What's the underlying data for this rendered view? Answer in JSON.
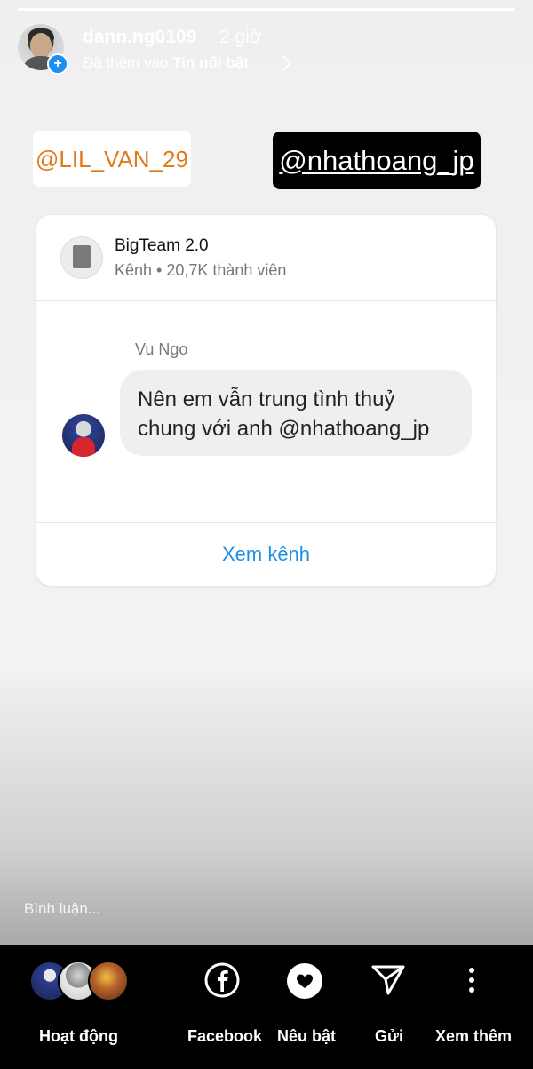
{
  "story": {
    "username": "dann.ng0109",
    "time": "2 giờ",
    "added_prefix": "Đã thêm vào",
    "added_target": "Tin nổi bật",
    "mentions": [
      "@LIL_VAN_29",
      "@nhathoang_jp"
    ]
  },
  "channel_card": {
    "name": "BigTeam 2.0",
    "meta": "Kênh • 20,7K thành viên",
    "sender": "Vu Ngo",
    "message_line1": "Nên em vẫn trung tình thuỷ",
    "message_line2": "chung với anh @nhathoang_jp",
    "view_button": "Xem kênh"
  },
  "comment_placeholder": "Bình luận...",
  "bottom_bar": {
    "activity_label": "Hoạt động",
    "facebook_label": "Facebook",
    "highlight_label": "Nêu bật",
    "send_label": "Gửi",
    "more_label": "Xem thêm"
  },
  "colors": {
    "accent_blue": "#1e90e6",
    "mention_orange": "#e07a1a"
  }
}
